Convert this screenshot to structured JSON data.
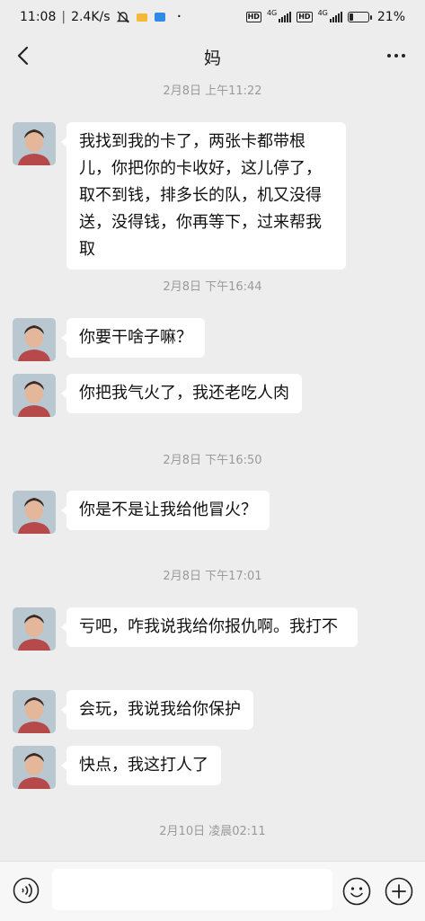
{
  "status_bar": {
    "time": "11:08",
    "net_speed": "2.4K/s",
    "network_type_1": "4G",
    "network_type_2": "4G",
    "battery_percent": "21%",
    "battery_level": 0.21
  },
  "nav": {
    "title": "妈"
  },
  "messages": [
    {
      "type": "timestamp",
      "text": "2月8日 上午11:22"
    },
    {
      "type": "message",
      "text": "我找到我的卡了，两张卡都带根儿，你把你的卡收好，这儿停了，取不到钱，排多长的队，机又没得送，没得钱，你再等下，过来帮我取"
    },
    {
      "type": "timestamp",
      "text": "2月8日 下午16:44"
    },
    {
      "type": "message",
      "text": "你要干啥子嘛？"
    },
    {
      "type": "message",
      "text": "你把我气火了，我还老吃人肉"
    },
    {
      "type": "timestamp",
      "text": "2月8日 下午16:50"
    },
    {
      "type": "message",
      "text": "你是不是让我给他冒火？"
    },
    {
      "type": "timestamp",
      "text": "2月8日 下午17:01"
    },
    {
      "type": "message",
      "text": "亏吧，咋我说我给你报仇啊。我打不"
    },
    {
      "type": "message",
      "text": "会玩，我说我给你保护"
    },
    {
      "type": "message",
      "text": "快点，我这打人了"
    },
    {
      "type": "timestamp",
      "text": "2月10日 凌晨02:11"
    }
  ],
  "input": {
    "value": "",
    "placeholder": ""
  }
}
